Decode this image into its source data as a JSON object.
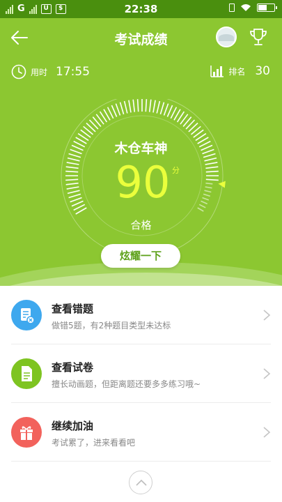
{
  "status_bar": {
    "carrier": "G",
    "sim_label": "$",
    "time": "22:38"
  },
  "header": {
    "title": "考试成绩",
    "back_icon": "arrow-left-icon",
    "trophy_icon": "trophy-icon"
  },
  "stats": {
    "time_label": "用时",
    "time_value": "17:55",
    "rank_label": "排名",
    "rank_value": "30"
  },
  "score": {
    "title": "木仓车神",
    "value": "90",
    "unit": "分",
    "result": "合格",
    "fraction": 0.9
  },
  "share_button": "炫耀一下",
  "menu": [
    {
      "title": "查看错题",
      "subtitle": "做错5题，有2种题目类型未达标",
      "icon": "wrong-questions-icon",
      "color": "#3ea8ee"
    },
    {
      "title": "查看试卷",
      "subtitle": "擅长动画题，但距离题还要多多练习哦~",
      "icon": "exam-paper-icon",
      "color": "#7ec421"
    },
    {
      "title": "继续加油",
      "subtitle": "考试累了，进来看看吧",
      "icon": "gift-icon",
      "color": "#f2625c"
    }
  ],
  "colors": {
    "header_bg": "#8cc731",
    "score_color": "#eaff3c"
  }
}
